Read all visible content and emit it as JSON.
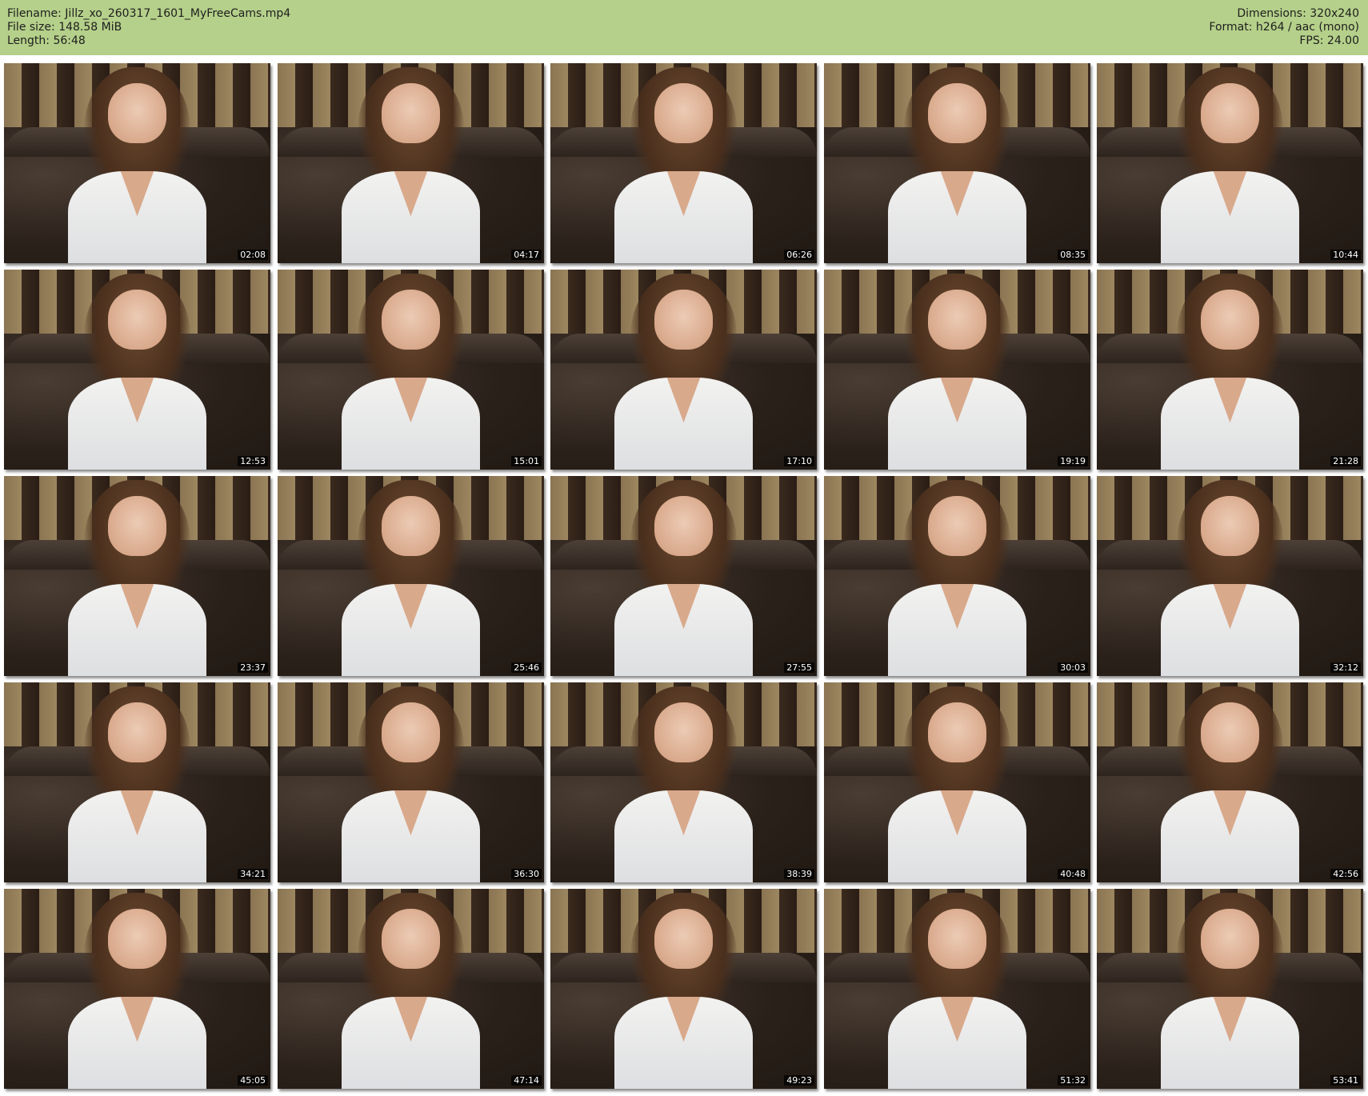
{
  "header": {
    "left": [
      "Filename: Jillz_xo_260317_1601_MyFreeCams.mp4",
      "File size: 148.58 MiB",
      "Length: 56:48"
    ],
    "right": [
      "Dimensions: 320x240",
      "Format: h264 / aac (mono)",
      "FPS: 24.00"
    ],
    "background_color": "#b5d08a"
  },
  "thumbnails": [
    {
      "timestamp": "02:08"
    },
    {
      "timestamp": "04:17"
    },
    {
      "timestamp": "06:26"
    },
    {
      "timestamp": "08:35"
    },
    {
      "timestamp": "10:44"
    },
    {
      "timestamp": "12:53"
    },
    {
      "timestamp": "15:01"
    },
    {
      "timestamp": "17:10"
    },
    {
      "timestamp": "19:19"
    },
    {
      "timestamp": "21:28"
    },
    {
      "timestamp": "23:37"
    },
    {
      "timestamp": "25:46"
    },
    {
      "timestamp": "27:55"
    },
    {
      "timestamp": "30:03"
    },
    {
      "timestamp": "32:12"
    },
    {
      "timestamp": "34:21"
    },
    {
      "timestamp": "36:30"
    },
    {
      "timestamp": "38:39"
    },
    {
      "timestamp": "40:48"
    },
    {
      "timestamp": "42:56"
    },
    {
      "timestamp": "45:05"
    },
    {
      "timestamp": "47:14"
    },
    {
      "timestamp": "49:23"
    },
    {
      "timestamp": "51:32"
    },
    {
      "timestamp": "53:41"
    }
  ]
}
